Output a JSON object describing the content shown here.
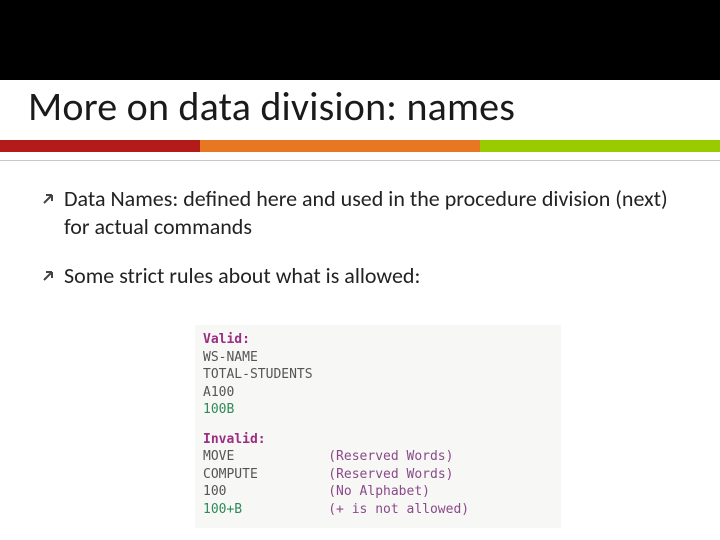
{
  "title": "More on data division: names",
  "bullets": [
    "Data Names: defined here and used in the procedure division (next) for actual commands",
    "Some strict rules about what is allowed:"
  ],
  "code": {
    "valid_label": "Valid:",
    "valid_lines": [
      "WS-NAME",
      "TOTAL-STUDENTS",
      "A100"
    ],
    "valid_last_green": "100B",
    "invalid_label": "Invalid:",
    "invalid_rows": [
      {
        "name": "MOVE",
        "note": "(Reserved Words)"
      },
      {
        "name": "COMPUTE",
        "note": "(Reserved Words)"
      },
      {
        "name": "100",
        "note": "(No Alphabet)"
      }
    ],
    "invalid_last": {
      "name": "100+B",
      "note": "(+ is not allowed)"
    }
  }
}
